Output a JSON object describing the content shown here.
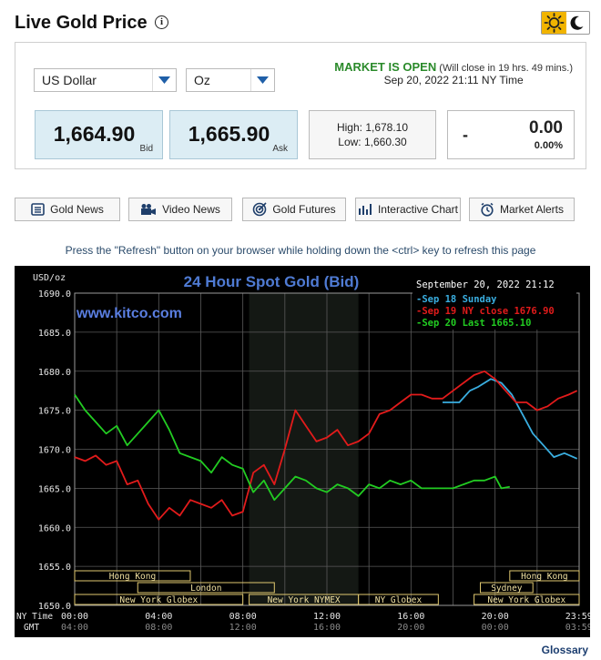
{
  "header": {
    "title": "Live Gold Price",
    "info_icon": "info-icon",
    "theme_icons": [
      "sun-icon",
      "moon-icon"
    ]
  },
  "controls": {
    "currency": "US Dollar",
    "unit": "Oz"
  },
  "market": {
    "status": "MARKET IS OPEN",
    "note": "(Will close in 19 hrs. 49 mins.)",
    "time": "Sep 20, 2022 21:11 NY Time"
  },
  "quote": {
    "bid": "1,664.90",
    "bid_label": "Bid",
    "ask": "1,665.90",
    "ask_label": "Ask",
    "high": "High: 1,678.10",
    "low": "Low: 1,660.30",
    "change_dash": "-",
    "change": "0.00",
    "change_pct": "0.00%"
  },
  "nav": [
    {
      "label": "Gold News",
      "icon": "newspaper-icon"
    },
    {
      "label": "Video News",
      "icon": "video-camera-icon"
    },
    {
      "label": "Gold Futures",
      "icon": "target-icon"
    },
    {
      "label": "Interactive Chart",
      "icon": "bar-chart-icon"
    },
    {
      "label": "Market Alerts",
      "icon": "alarm-clock-icon"
    }
  ],
  "refresh_note": "Press the \"Refresh\" button on your browser while holding down the <ctrl> key to refresh this page",
  "glossary": "Glossary",
  "colors": {
    "sep18": "#3aaee0",
    "sep19": "#e21b1b",
    "sep20": "#22cc22",
    "title": "#4f7bd4",
    "watermark": "#5a7ee0"
  },
  "chart_data": {
    "type": "line",
    "title": "24 Hour Spot Gold (Bid)",
    "watermark": "www.kitco.com",
    "ylabel": "USD/oz",
    "timestamp": "September 20, 2022 21:12",
    "ylim": [
      1650,
      1690
    ],
    "yticks": [
      "1650.0",
      "1655.0",
      "1660.0",
      "1665.0",
      "1670.0",
      "1675.0",
      "1680.0",
      "1685.0",
      "1690.0"
    ],
    "x_label_ny": "NY Time",
    "x_label_gmt": "GMT",
    "xticks_ny": [
      "00:00",
      "04:00",
      "08:00",
      "12:00",
      "16:00",
      "20:00",
      "23:59"
    ],
    "xticks_gmt": [
      "04:00",
      "08:00",
      "12:00",
      "16:00",
      "20:00",
      "00:00",
      "03:59"
    ],
    "legend": [
      {
        "label": "Sep 18 Sunday",
        "color": "#3aaee0"
      },
      {
        "label": "Sep 19 NY close 1676.90",
        "color": "#e21b1b"
      },
      {
        "label": "Sep 20 Last 1665.10",
        "color": "#22cc22"
      }
    ],
    "sessions": [
      {
        "label": "Hong Kong",
        "start": 0,
        "end": 5.5,
        "row": 0
      },
      {
        "label": "London",
        "start": 3,
        "end": 9.5,
        "row": 1
      },
      {
        "label": "New York Globex",
        "start": 0,
        "end": 8,
        "row": 2
      },
      {
        "label": "New York NYMEX",
        "start": 8.3,
        "end": 13.5,
        "row": 2
      },
      {
        "label": "NY Globex",
        "start": 13.5,
        "end": 17.3,
        "row": 2
      },
      {
        "label": "Hong Kong",
        "start": 20.7,
        "end": 24,
        "row": 0
      },
      {
        "label": "Sydney",
        "start": 19.3,
        "end": 21.8,
        "row": 1
      },
      {
        "label": "New York Globex",
        "start": 19,
        "end": 24,
        "row": 2
      }
    ],
    "series": [
      {
        "name": "Sep 18 Sunday",
        "x": [
          17.5,
          18.3,
          18.8,
          19.2,
          19.8,
          20.3,
          20.8,
          21.4,
          21.8,
          22.3,
          22.8,
          23.3,
          23.9
        ],
        "y": [
          1676.0,
          1676.0,
          1677.5,
          1678.0,
          1679.0,
          1678.5,
          1677.0,
          1674.0,
          1672.0,
          1670.5,
          1669.0,
          1669.5,
          1668.8
        ]
      },
      {
        "name": "Sep 19 NY close 1676.90",
        "x": [
          0,
          0.5,
          1.0,
          1.5,
          2.0,
          2.5,
          3.0,
          3.5,
          4.0,
          4.5,
          5.0,
          5.5,
          6.0,
          6.5,
          7.0,
          7.5,
          8.0,
          8.5,
          9.0,
          9.5,
          10.0,
          10.5,
          11.0,
          11.5,
          12.0,
          12.5,
          13.0,
          13.5,
          14.0,
          14.5,
          15.0,
          15.5,
          16.0,
          16.5,
          17.0,
          17.5,
          18.0,
          18.5,
          19.0,
          19.5,
          20.0,
          20.5,
          21.0,
          21.5,
          22.0,
          22.5,
          23.0,
          23.5,
          23.9
        ],
        "y": [
          1669,
          1668.5,
          1669.2,
          1668.0,
          1668.5,
          1665.5,
          1666.0,
          1663.0,
          1661.0,
          1662.5,
          1661.5,
          1663.5,
          1663.0,
          1662.5,
          1663.5,
          1661.5,
          1662.0,
          1667.0,
          1668.0,
          1665.5,
          1670.0,
          1675.0,
          1673.0,
          1671.0,
          1671.5,
          1672.5,
          1670.5,
          1671.0,
          1672.0,
          1674.5,
          1675.0,
          1676.0,
          1677.0,
          1677.0,
          1676.5,
          1676.5,
          1677.5,
          1678.5,
          1679.5,
          1680.0,
          1679.0,
          1677.5,
          1676.0,
          1676.0,
          1675.0,
          1675.5,
          1676.5,
          1677.0,
          1677.5
        ]
      },
      {
        "name": "Sep 20 Last 1665.10",
        "x": [
          0,
          0.5,
          1.0,
          1.5,
          2.0,
          2.5,
          3.0,
          3.5,
          4.0,
          4.5,
          5.0,
          5.5,
          6.0,
          6.5,
          7.0,
          7.5,
          8.0,
          8.5,
          9.0,
          9.5,
          10.0,
          10.5,
          11.0,
          11.5,
          12.0,
          12.5,
          13.0,
          13.5,
          14.0,
          14.5,
          15.0,
          15.5,
          16.0,
          16.5,
          17.0,
          17.5,
          18.0,
          18.5,
          19.0,
          19.5,
          20.0,
          20.3,
          20.7
        ],
        "y": [
          1677.0,
          1675.0,
          1673.5,
          1672.0,
          1673.0,
          1670.5,
          1672.0,
          1673.5,
          1675.0,
          1672.5,
          1669.5,
          1669.0,
          1668.5,
          1667.0,
          1669.0,
          1668.0,
          1667.5,
          1664.5,
          1666.0,
          1663.5,
          1665.0,
          1666.5,
          1666.0,
          1665.0,
          1664.5,
          1665.5,
          1665.0,
          1664.0,
          1665.5,
          1665.0,
          1666.0,
          1665.5,
          1666.0,
          1665.0,
          1665.0,
          1665.0,
          1665.0,
          1665.5,
          1666.0,
          1666.0,
          1666.5,
          1665.0,
          1665.2
        ]
      }
    ]
  }
}
